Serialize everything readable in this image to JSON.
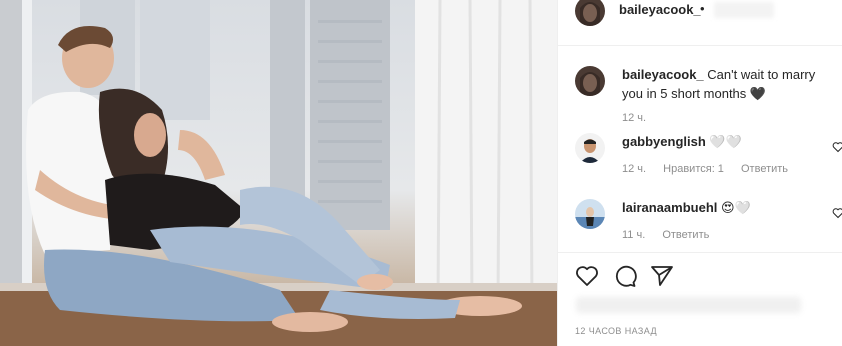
{
  "post": {
    "author": "baileyacook_",
    "header_separator": "•",
    "caption_username": "baileyacook_",
    "caption_text": "Can't wait to marry you in 5 short months",
    "caption_emoji": "🖤",
    "caption_time": "12 ч.",
    "timestamp": "12 ЧАСОВ НАЗАД"
  },
  "comments": [
    {
      "username": "gabbyenglish",
      "text": "🤍🤍",
      "time": "12 ч.",
      "likes": "Нравится: 1",
      "reply": "Ответить"
    },
    {
      "username": "lairanaambuehl",
      "text": "😍🤍",
      "time": "11 ч.",
      "reply": "Ответить"
    }
  ],
  "icons": {
    "like": "heart-icon",
    "comment": "comment-icon",
    "share": "paper-plane-icon"
  },
  "colors": {
    "text": "#262626",
    "muted": "#8e8e8e",
    "border": "#efefef"
  }
}
